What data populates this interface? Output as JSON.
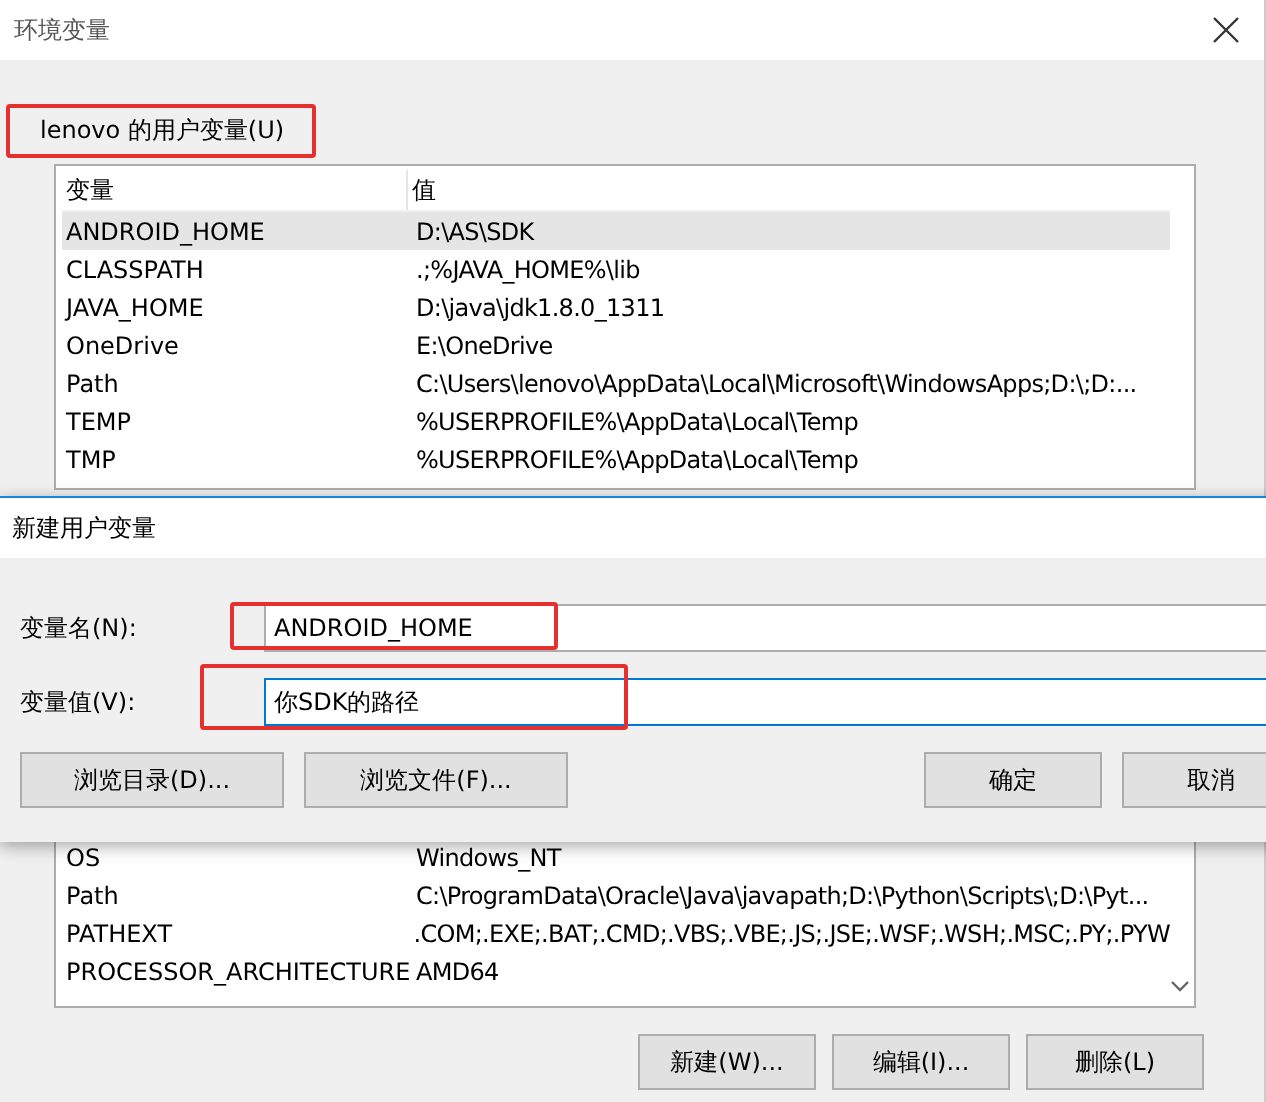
{
  "window": {
    "title": "环境变量"
  },
  "user_variables": {
    "label": "lenovo 的用户变量(U)",
    "highlighted": true,
    "columns": [
      "变量",
      "值"
    ],
    "rows": [
      {
        "name": "ANDROID_HOME",
        "value": "D:\\AS\\SDK",
        "selected": true
      },
      {
        "name": "CLASSPATH",
        "value": ".;%JAVA_HOME%\\lib",
        "selected": false
      },
      {
        "name": "JAVA_HOME",
        "value": "D:\\java\\jdk1.8.0_1311",
        "selected": false
      },
      {
        "name": "OneDrive",
        "value": "E:\\OneDrive",
        "selected": false
      },
      {
        "name": "Path",
        "value": "C:\\Users\\lenovo\\AppData\\Local\\Microsoft\\WindowsApps;D:\\;D:...",
        "selected": false
      },
      {
        "name": "TEMP",
        "value": "%USERPROFILE%\\AppData\\Local\\Temp",
        "selected": false
      },
      {
        "name": "TMP",
        "value": "%USERPROFILE%\\AppData\\Local\\Temp",
        "selected": false
      }
    ]
  },
  "system_variables": {
    "rows": [
      {
        "name": "OS",
        "value": "Windows_NT",
        "selected": false
      },
      {
        "name": "Path",
        "value": "C:\\ProgramData\\Oracle\\Java\\javapath;D:\\Python\\Scripts\\;D:\\Pyt...",
        "selected": false
      },
      {
        "name": "PATHEXT",
        "value": ".COM;.EXE;.BAT;.CMD;.VBS;.VBE;.JS;.JSE;.WSF;.WSH;.MSC;.PY;.PYW",
        "selected": false
      },
      {
        "name": "PROCESSOR_ARCHITECTURE",
        "value": "AMD64",
        "selected": false
      }
    ],
    "buttons": [
      "新建(W)...",
      "编辑(I)...",
      "删除(L)"
    ]
  },
  "dialog": {
    "title": "新建用户变量",
    "fields": [
      {
        "label": "变量名(N):",
        "value": "ANDROID_HOME",
        "highlighted": true,
        "focused": false
      },
      {
        "label": "变量值(V):",
        "value": "你SDK的路径",
        "highlighted": true,
        "focused": true
      }
    ],
    "left_buttons": [
      "浏览目录(D)...",
      "浏览文件(F)..."
    ],
    "right_buttons": [
      "确定",
      "取消"
    ]
  }
}
